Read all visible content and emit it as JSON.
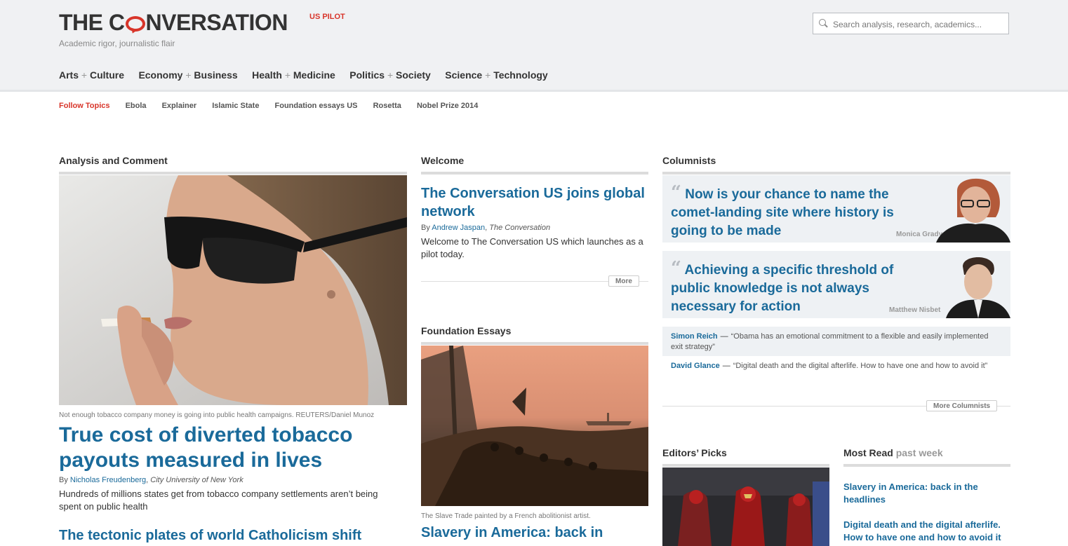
{
  "header": {
    "logo_text_pre": "THE C",
    "logo_text_post": "NVERSATION",
    "edition_badge": "US PILOT",
    "tagline": "Academic rigor, journalistic flair",
    "search_placeholder": "Search analysis, research, academics..."
  },
  "nav": [
    {
      "a": "Arts",
      "b": "Culture"
    },
    {
      "a": "Economy",
      "b": "Business"
    },
    {
      "a": "Health",
      "b": "Medicine"
    },
    {
      "a": "Politics",
      "b": "Society"
    },
    {
      "a": "Science",
      "b": "Technology"
    }
  ],
  "topics": {
    "label": "Follow Topics",
    "items": [
      "Ebola",
      "Explainer",
      "Islamic State",
      "Foundation essays US",
      "Rosetta",
      "Nobel Prize 2014"
    ]
  },
  "analysis": {
    "heading": "Analysis and Comment",
    "caption": "Not enough tobacco company money is going into public health campaigns. REUTERS/Daniel Munoz",
    "title": "True cost of diverted tobacco payouts measured in lives",
    "by": "By",
    "author": "Nicholas Freudenberg",
    "org": "City University of New York",
    "summary": "Hundreds of millions states get from tobacco company settlements aren’t being spent on public health",
    "next_title": "The tectonic plates of world Catholicism shift"
  },
  "welcome": {
    "heading": "Welcome",
    "title": "The Conversation US joins global network",
    "by": "By",
    "author": "Andrew Jaspan",
    "org": "The Conversation",
    "summary": "Welcome to The Conversation US which launches as a pilot today.",
    "more_label": "More"
  },
  "foundation": {
    "heading": "Foundation Essays",
    "caption": "The Slave Trade painted by a French abolitionist artist.",
    "title": "Slavery in America: back in"
  },
  "columnists": {
    "heading": "Columnists",
    "featured": [
      {
        "quote": "Now is your chance to name the comet-landing site where history is going to be made",
        "name": "Monica Grady"
      },
      {
        "quote": "Achieving a specific threshold of public knowledge is not always necessary for action",
        "name": "Matthew Nisbet"
      }
    ],
    "snippets": [
      {
        "author": "Simon Reich",
        "dash": "—",
        "quote": "“Obama has an emotional commitment to a flexible and easily implemented exit strategy”"
      },
      {
        "author": "David Glance",
        "dash": "—",
        "quote": "“Digital death and the digital afterlife. How to have one and how to avoid it”"
      }
    ],
    "more_label": "More Columnists"
  },
  "editors_picks": {
    "heading": "Editors’ Picks"
  },
  "most_read": {
    "heading": "Most Read",
    "heading_muted": "past week",
    "items": [
      "Slavery in America: back in the headlines",
      "Digital death and the digital afterlife. How to have one and how to avoid it"
    ]
  }
}
